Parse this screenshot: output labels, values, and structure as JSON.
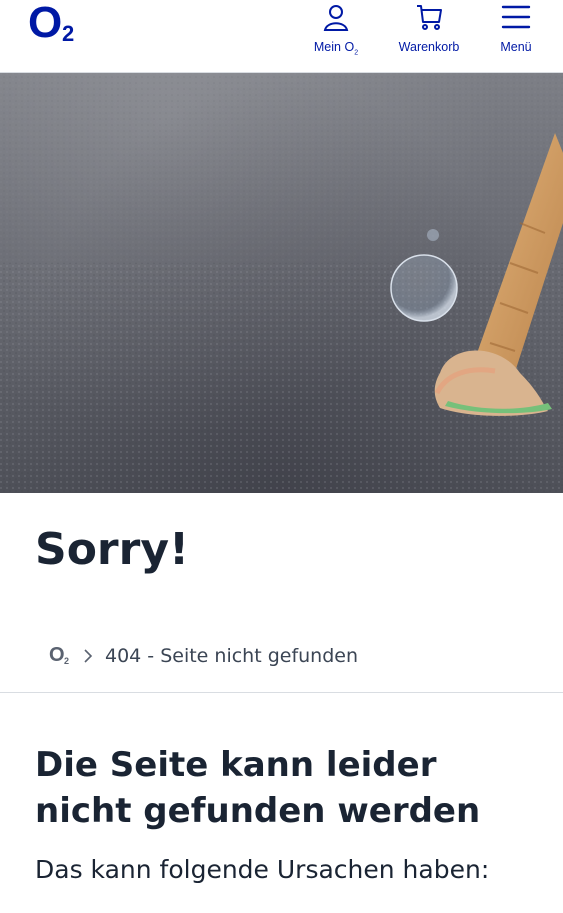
{
  "header": {
    "logo_main": "O",
    "logo_sub": "2",
    "nav": [
      {
        "label": "Mein O",
        "sub": "2",
        "icon": "user-icon"
      },
      {
        "label": "Warenkorb",
        "icon": "cart-icon"
      },
      {
        "label": "Menü",
        "icon": "hamburger-menu-icon"
      }
    ]
  },
  "hero": {
    "image": "dropped-ice-cream-cone-on-asphalt-photo"
  },
  "page": {
    "sorry_title": "Sorry!",
    "breadcrumb": {
      "home_main": "O",
      "home_sub": "2",
      "current": "404 - Seite nicht gefunden"
    },
    "heading": "Die Seite kann leider nicht gefunden werden",
    "intro": "Das kann folgende Ursachen haben:"
  },
  "colors": {
    "brand": "#0019a5",
    "text": "#1a2433",
    "divider": "#d9dde2"
  }
}
